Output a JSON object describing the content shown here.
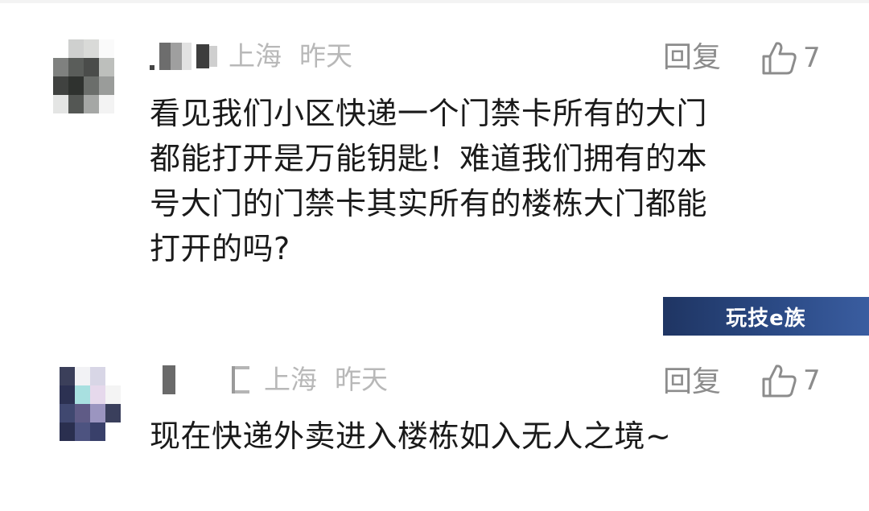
{
  "comments": [
    {
      "location": "上海",
      "time": "昨天",
      "reply_label": "回复",
      "like_count": "7",
      "content_lines": [
        "看见我们小区快递一个门禁卡所有的大门",
        "都能打开是万能钥匙！难道我们拥有的本",
        "号大门的门禁卡其实所有的楼栋大门都能",
        "打开的吗?"
      ]
    },
    {
      "location": "上海",
      "time": "昨天",
      "reply_label": "回复",
      "like_count": "7",
      "content_lines": [
        "现在快递外卖进入楼栋如入无人之境~"
      ]
    }
  ],
  "watermark": {
    "text": "玩技e族"
  },
  "icons": {
    "like": "thumbs-up-icon"
  },
  "colors": {
    "text": "#1a1a1a",
    "meta": "#b8b8b8",
    "action": "#8c8c8c",
    "watermark_bg": "#2b4a85"
  }
}
